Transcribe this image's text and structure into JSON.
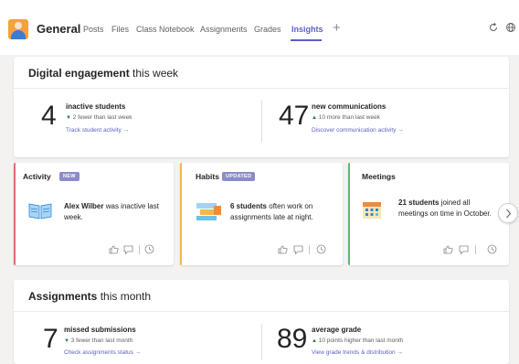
{
  "header": {
    "team_name": "General",
    "tabs": [
      {
        "label": "Posts"
      },
      {
        "label": "Files"
      },
      {
        "label": "Class Notebook"
      },
      {
        "label": "Assignments"
      },
      {
        "label": "Grades"
      },
      {
        "label": "Insights"
      }
    ],
    "active_tab": "Insights",
    "add_tab": "+"
  },
  "engagement": {
    "title_bold": "Digital engagement",
    "title_rest": " this week",
    "left": {
      "value": "4",
      "label": "inactive students",
      "delta": "2 fewer than last week",
      "link": "Track student activity →"
    },
    "right": {
      "value": "47",
      "label": "new communications",
      "delta": "10 more than last week",
      "link": "Discover communication activity →"
    }
  },
  "cards": [
    {
      "title": "Activity",
      "badge": "NEW",
      "text_bold": "Alex Wilber",
      "text_rest": " was inactive last week."
    },
    {
      "title": "Habits",
      "badge": "UPDATED",
      "text_bold": "6 students",
      "text_rest": " often work on assignments late at night."
    },
    {
      "title": "Meetings",
      "badge": "",
      "text_bold": "21 students",
      "text_rest": " joined all meetings on time in October."
    }
  ],
  "assignments": {
    "title_bold": "Assignments",
    "title_rest": " this month",
    "left": {
      "value": "7",
      "label": "missed submissions",
      "delta": "3 fewer than last month",
      "link": "Check assignments status →"
    },
    "right": {
      "value": "89",
      "label": "average grade",
      "delta": "10 points higher than last month",
      "link": "View grade trends & distribution →"
    }
  },
  "colors": {
    "accent": "#5b5fc7",
    "activity": "#e86a6a",
    "habits": "#f5b83d",
    "meetings": "#5bb974",
    "delta_green": "#237b4b"
  }
}
